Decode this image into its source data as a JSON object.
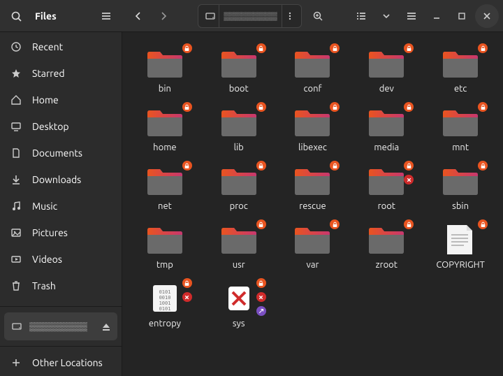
{
  "app": {
    "title": "Files"
  },
  "pathbar": {
    "location": "▒▒▒▒▒▒▒▒▒"
  },
  "sidebar": {
    "items": [
      {
        "name": "recent",
        "label": "Recent",
        "icon": "clock"
      },
      {
        "name": "starred",
        "label": "Starred",
        "icon": "star"
      },
      {
        "name": "home",
        "label": "Home",
        "icon": "home"
      },
      {
        "name": "desktop",
        "label": "Desktop",
        "icon": "desktop"
      },
      {
        "name": "documents",
        "label": "Documents",
        "icon": "document"
      },
      {
        "name": "downloads",
        "label": "Downloads",
        "icon": "download"
      },
      {
        "name": "music",
        "label": "Music",
        "icon": "music"
      },
      {
        "name": "pictures",
        "label": "Pictures",
        "icon": "picture"
      },
      {
        "name": "videos",
        "label": "Videos",
        "icon": "video"
      },
      {
        "name": "trash",
        "label": "Trash",
        "icon": "trash"
      }
    ],
    "device": {
      "label": "▒▒▒▒▒▒▒▒▒"
    },
    "other_locations": "Other Locations"
  },
  "folders": [
    {
      "name": "bin",
      "type": "folder",
      "badges": [
        "lock"
      ]
    },
    {
      "name": "boot",
      "type": "folder",
      "badges": [
        "lock"
      ]
    },
    {
      "name": "conf",
      "type": "folder",
      "badges": [
        "lock"
      ]
    },
    {
      "name": "dev",
      "type": "folder",
      "badges": [
        "lock"
      ]
    },
    {
      "name": "etc",
      "type": "folder",
      "badges": [
        "lock"
      ]
    },
    {
      "name": "home",
      "type": "folder",
      "badges": [
        "lock"
      ]
    },
    {
      "name": "lib",
      "type": "folder",
      "badges": [
        "lock"
      ]
    },
    {
      "name": "libexec",
      "type": "folder",
      "badges": [
        "lock"
      ]
    },
    {
      "name": "media",
      "type": "folder",
      "badges": [
        "lock"
      ]
    },
    {
      "name": "mnt",
      "type": "folder",
      "badges": [
        "lock"
      ]
    },
    {
      "name": "net",
      "type": "folder",
      "badges": [
        "lock"
      ]
    },
    {
      "name": "proc",
      "type": "folder",
      "badges": [
        "lock"
      ]
    },
    {
      "name": "rescue",
      "type": "folder",
      "badges": [
        "lock"
      ]
    },
    {
      "name": "root",
      "type": "folder",
      "badges": [
        "lock",
        "x"
      ]
    },
    {
      "name": "sbin",
      "type": "folder",
      "badges": [
        "lock"
      ]
    },
    {
      "name": "tmp",
      "type": "folder",
      "badges": []
    },
    {
      "name": "usr",
      "type": "folder",
      "badges": [
        "lock"
      ]
    },
    {
      "name": "var",
      "type": "folder",
      "badges": [
        "lock"
      ]
    },
    {
      "name": "zroot",
      "type": "folder",
      "badges": [
        "lock"
      ]
    },
    {
      "name": "COPYRIGHT",
      "type": "file-text",
      "badges": [
        "lock"
      ]
    },
    {
      "name": "entropy",
      "type": "file-binary",
      "badges": [
        "lock",
        "x"
      ]
    },
    {
      "name": "sys",
      "type": "file-broken",
      "badges": [
        "lock",
        "x",
        "link"
      ]
    }
  ],
  "colors": {
    "accent": "#e95420",
    "folder_top": "#d24b6f",
    "folder_body": "#6a6a6a"
  }
}
